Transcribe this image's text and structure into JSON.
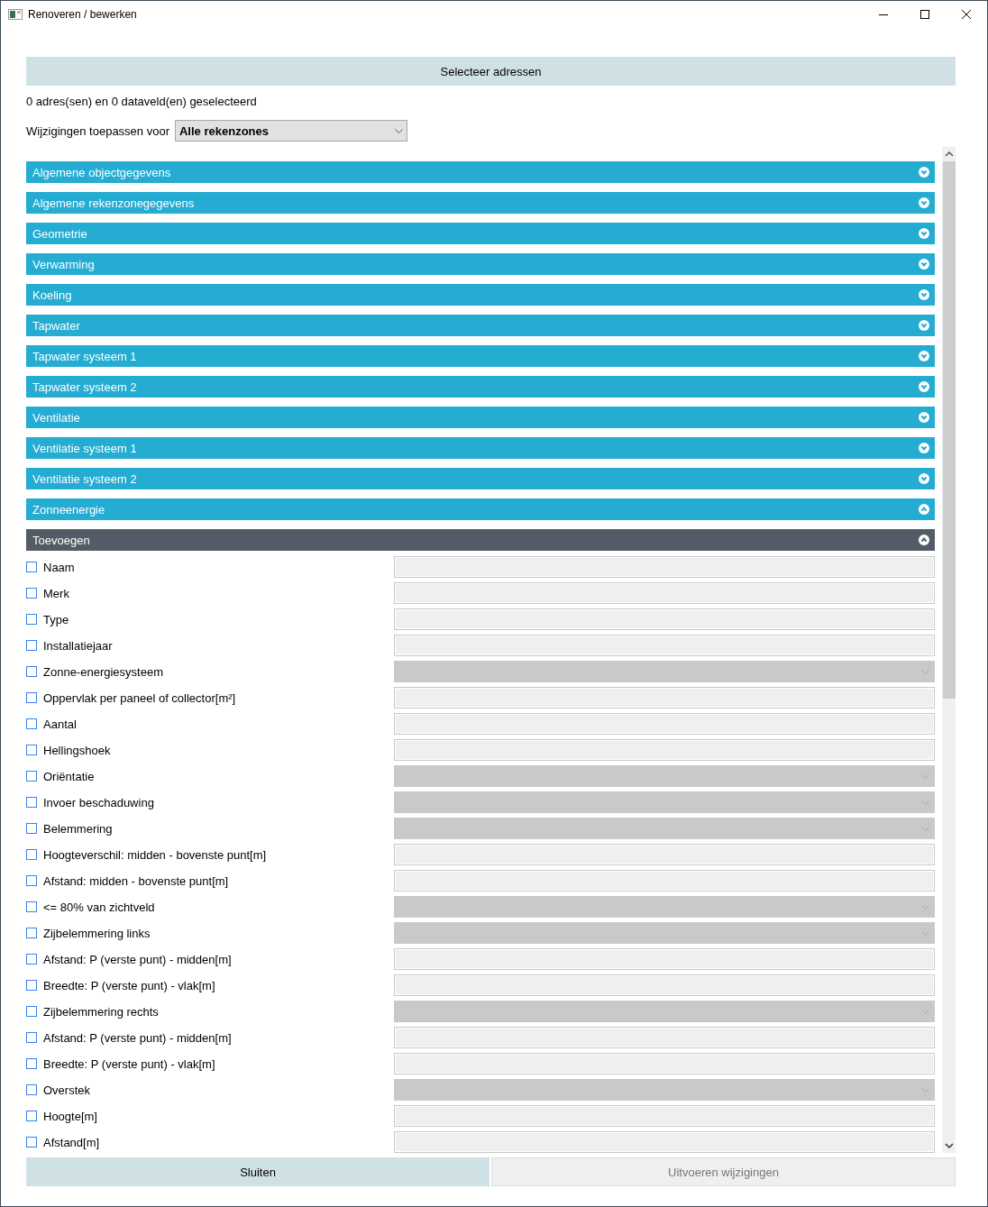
{
  "window": {
    "title": "Renoveren / bewerken"
  },
  "select_button": "Selecteer adressen",
  "selection_summary": "0 adres(sen) en 0 dataveld(en) geselecteerd",
  "apply_for": {
    "label": "Wijzigingen toepassen voor",
    "value": "Alle rekenzones"
  },
  "sections": [
    {
      "title": "Algemene objectgegevens",
      "kind": "section",
      "expanded": false
    },
    {
      "title": "Algemene rekenzonegegevens",
      "kind": "section",
      "expanded": false
    },
    {
      "title": "Geometrie",
      "kind": "section",
      "expanded": false
    },
    {
      "title": "Verwarming",
      "kind": "section",
      "expanded": false
    },
    {
      "title": "Koeling",
      "kind": "section",
      "expanded": false
    },
    {
      "title": "Tapwater",
      "kind": "section",
      "expanded": false
    },
    {
      "title": "Tapwater systeem 1",
      "kind": "section",
      "expanded": false
    },
    {
      "title": "Tapwater systeem 2",
      "kind": "section",
      "expanded": false
    },
    {
      "title": "Ventilatie",
      "kind": "section",
      "expanded": false
    },
    {
      "title": "Ventilatie systeem 1",
      "kind": "section",
      "expanded": false
    },
    {
      "title": "Ventilatie systeem 2",
      "kind": "section",
      "expanded": false
    },
    {
      "title": "Zonneenergie",
      "kind": "section",
      "expanded": true
    },
    {
      "title": "Toevoegen",
      "kind": "subsection",
      "expanded": true
    }
  ],
  "fields": [
    {
      "label": "Naam",
      "kind": "text",
      "checked": false
    },
    {
      "label": "Merk",
      "kind": "text",
      "checked": false
    },
    {
      "label": "Type",
      "kind": "text",
      "checked": false
    },
    {
      "label": "Installatiejaar",
      "kind": "text",
      "checked": false
    },
    {
      "label": "Zonne-energiesysteem",
      "kind": "select",
      "checked": false
    },
    {
      "label": "Oppervlak per paneel of collector[m²]",
      "kind": "text",
      "checked": false
    },
    {
      "label": "Aantal",
      "kind": "text",
      "checked": false
    },
    {
      "label": "Hellingshoek",
      "kind": "text",
      "checked": false
    },
    {
      "label": "Oriëntatie",
      "kind": "select",
      "checked": false
    },
    {
      "label": "Invoer beschaduwing",
      "kind": "select",
      "checked": false
    },
    {
      "label": "Belemmering",
      "kind": "select",
      "checked": false
    },
    {
      "label": "Hoogteverschil: midden - bovenste punt[m]",
      "kind": "text",
      "checked": false
    },
    {
      "label": "Afstand: midden - bovenste punt[m]",
      "kind": "text",
      "checked": false
    },
    {
      "label": "<= 80% van zichtveld",
      "kind": "select",
      "checked": false
    },
    {
      "label": "Zijbelemmering links",
      "kind": "select",
      "checked": false
    },
    {
      "label": "Afstand: P (verste punt) - midden[m]",
      "kind": "text",
      "checked": false
    },
    {
      "label": "Breedte: P (verste punt) - vlak[m]",
      "kind": "text",
      "checked": false
    },
    {
      "label": "Zijbelemmering rechts",
      "kind": "select",
      "checked": false
    },
    {
      "label": "Afstand: P (verste punt) - midden[m]",
      "kind": "text",
      "checked": false
    },
    {
      "label": "Breedte: P (verste punt) - vlak[m]",
      "kind": "text",
      "checked": false
    },
    {
      "label": "Overstek",
      "kind": "select",
      "checked": false
    },
    {
      "label": "Hoogte[m]",
      "kind": "text",
      "checked": false
    },
    {
      "label": "Afstand[m]",
      "kind": "text",
      "checked": false
    }
  ],
  "buttons": [
    {
      "label": "Sluiten",
      "disabled": false
    },
    {
      "label": "Uitvoeren wijzigingen",
      "disabled": true
    }
  ]
}
